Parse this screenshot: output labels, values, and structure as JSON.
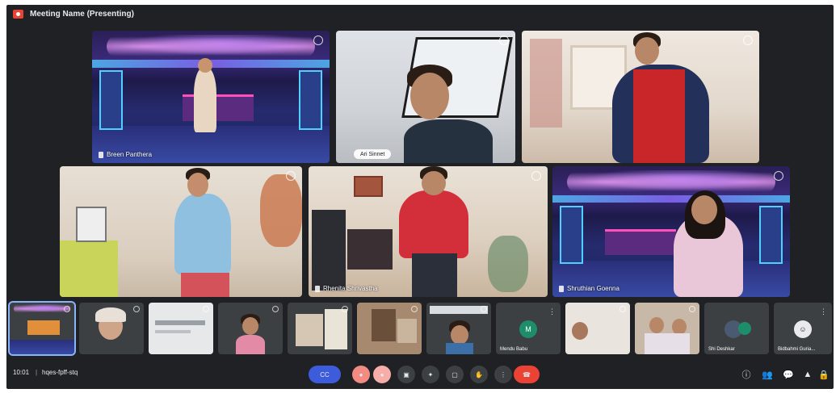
{
  "meeting": {
    "title": "Meeting Name (Presenting)"
  },
  "tiles": [
    {
      "name": "Breen Panthera"
    },
    {
      "name": "",
      "chip": "Ari Sinnet"
    },
    {
      "name": ""
    },
    {
      "name": ""
    },
    {
      "name": "Rhenita Shrivastha"
    },
    {
      "name": "Shruthian Goenna"
    }
  ],
  "thumbs": [
    {
      "name": ""
    },
    {
      "name": ""
    },
    {
      "name": ""
    },
    {
      "name": ""
    },
    {
      "name": ""
    },
    {
      "name": ""
    },
    {
      "name": ""
    },
    {
      "name": "Mendu Babu",
      "initial": "M"
    },
    {
      "name": ""
    },
    {
      "name": ""
    },
    {
      "name": "Shi Deshkar"
    },
    {
      "name": "Bidbahmi Guria..."
    }
  ],
  "bottombar": {
    "clock": "10:01",
    "separator": "|",
    "meeting_code": "hqes-fpff-stq",
    "cc_label": "CC",
    "end_label": ""
  },
  "icons": {
    "record": "record-icon",
    "mic": "mic-icon",
    "camera": "camera-icon",
    "present": "present-icon",
    "raise_hand": "raise-hand-icon",
    "more": "more-icon",
    "info": "info-icon",
    "people": "people-icon",
    "chat": "chat-icon",
    "activities": "activities-icon",
    "lock": "lock-icon"
  },
  "colors": {
    "background": "#202124",
    "end_call": "#ea4335",
    "captions": "#3c5cdb",
    "selected_outline": "#8ab4f8"
  }
}
